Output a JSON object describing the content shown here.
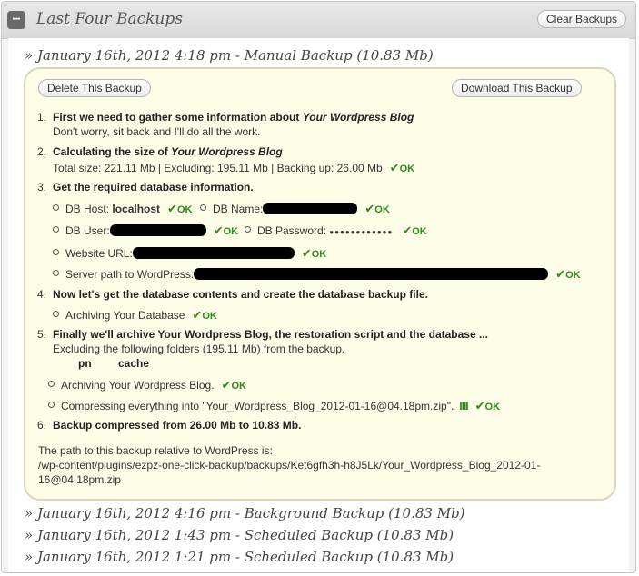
{
  "panel": {
    "toggle_symbol": "−",
    "title": "Last Four Backups",
    "clear_button": "Clear Backups"
  },
  "backups": [
    {
      "heading": "» January 16th, 2012 4:18 pm - Manual Backup (10.83 Mb)",
      "delete_button": "Delete This Backup",
      "download_button": "Download This Backup",
      "steps": {
        "s1_num": "1.",
        "s1_title_a": "First we need to gather some information about ",
        "s1_title_b": "Your Wordpress Blog",
        "s1_sub": "Don't worry, sit back and I'll do all the work.",
        "s2_num": "2.",
        "s2_title_a": "Calculating the size of ",
        "s2_title_b": "Your Wordpress Blog",
        "s2_sub": "Total size: 221.11 Mb | Excluding: 195.11 Mb | Backing up: 26.00 Mb",
        "s3_num": "3.",
        "s3_title": "Get the required database information.",
        "db_host_label": "DB Host: ",
        "db_host_value": "localhost",
        "db_name_label": "DB Name:",
        "db_user_label": "DB User:",
        "db_password_label": "DB Password: ",
        "db_password_value": "●●●●●●●●●●●●",
        "website_url_label": "Website URL:",
        "server_path_label": "Server path to WordPress:",
        "s4_num": "4.",
        "s4_title": "Now let's get the database contents and create the database backup file.",
        "s4_item": "Archiving Your Database",
        "s5_num": "5.",
        "s5_title": "Finally we'll archive Your Wordpress Blog, the restoration script and the database ...",
        "s5_sub": "Excluding the following folders (195.11 Mb) from the backup.",
        "excluded_1": "pn",
        "excluded_2": "cache",
        "s5_item1": "Archiving Your Wordpress Blog.",
        "s5_item2": "Compressing everything into \"Your_Wordpress_Blog_2012-01-16@04.18pm.zip\".",
        "progress_bars": "IIII",
        "s6_num": "6.",
        "s6_title": "Backup compressed from 26.00 Mb to 10.83 Mb.",
        "path_intro": "The path to this backup relative to WordPress is:",
        "path_line1": "/wp-content/plugins/ezpz-one-click-backup/backups/Ket6gfh3h-h8J5Lk/Your_Wordpress_Blog_2012-01-",
        "path_line2": "16@04.18pm.zip"
      },
      "ok_label": "OK",
      "ok_check": "✔"
    },
    {
      "heading": "» January 16th, 2012 4:16 pm - Background Backup (10.83 Mb)"
    },
    {
      "heading": "» January 16th, 2012 1:43 pm - Scheduled Backup (10.83 Mb)"
    },
    {
      "heading": "» January 16th, 2012 1:21 pm - Scheduled Backup (10.83 Mb)"
    }
  ],
  "colors": {
    "ok": "#2e8a1c",
    "card_bg": "#fefee8",
    "card_border": "#d7d8b6"
  }
}
